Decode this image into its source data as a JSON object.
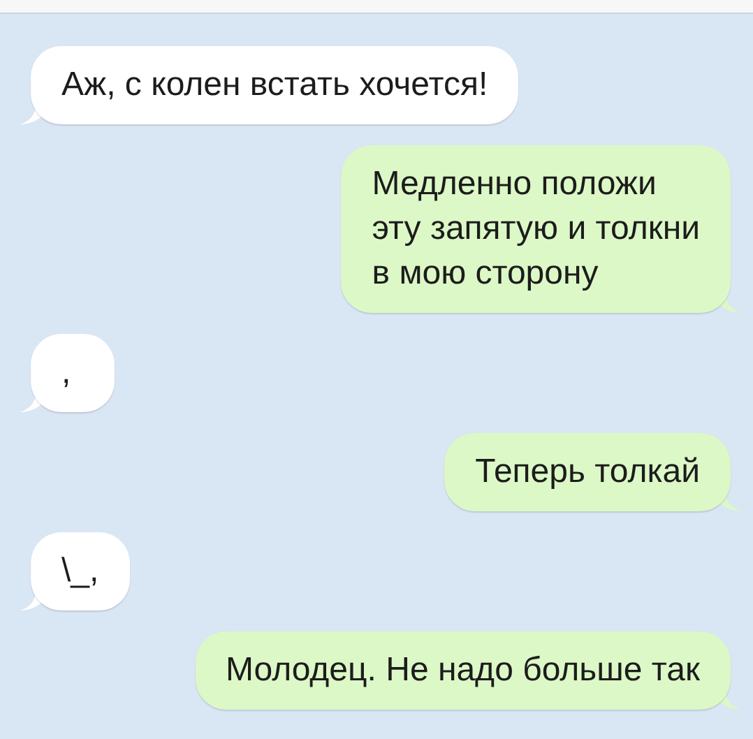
{
  "messages": [
    {
      "kind": "incoming",
      "text": "Аж, с колен встать хочется!"
    },
    {
      "kind": "outgoing",
      "text": "Медленно положи\nэту запятую и толкни\nв мою сторону"
    },
    {
      "kind": "incoming",
      "text": ","
    },
    {
      "kind": "outgoing",
      "text": "Теперь толкай"
    },
    {
      "kind": "incoming",
      "text": "\\_,"
    },
    {
      "kind": "outgoing",
      "text": "Молодец. Не надо больше так"
    }
  ]
}
